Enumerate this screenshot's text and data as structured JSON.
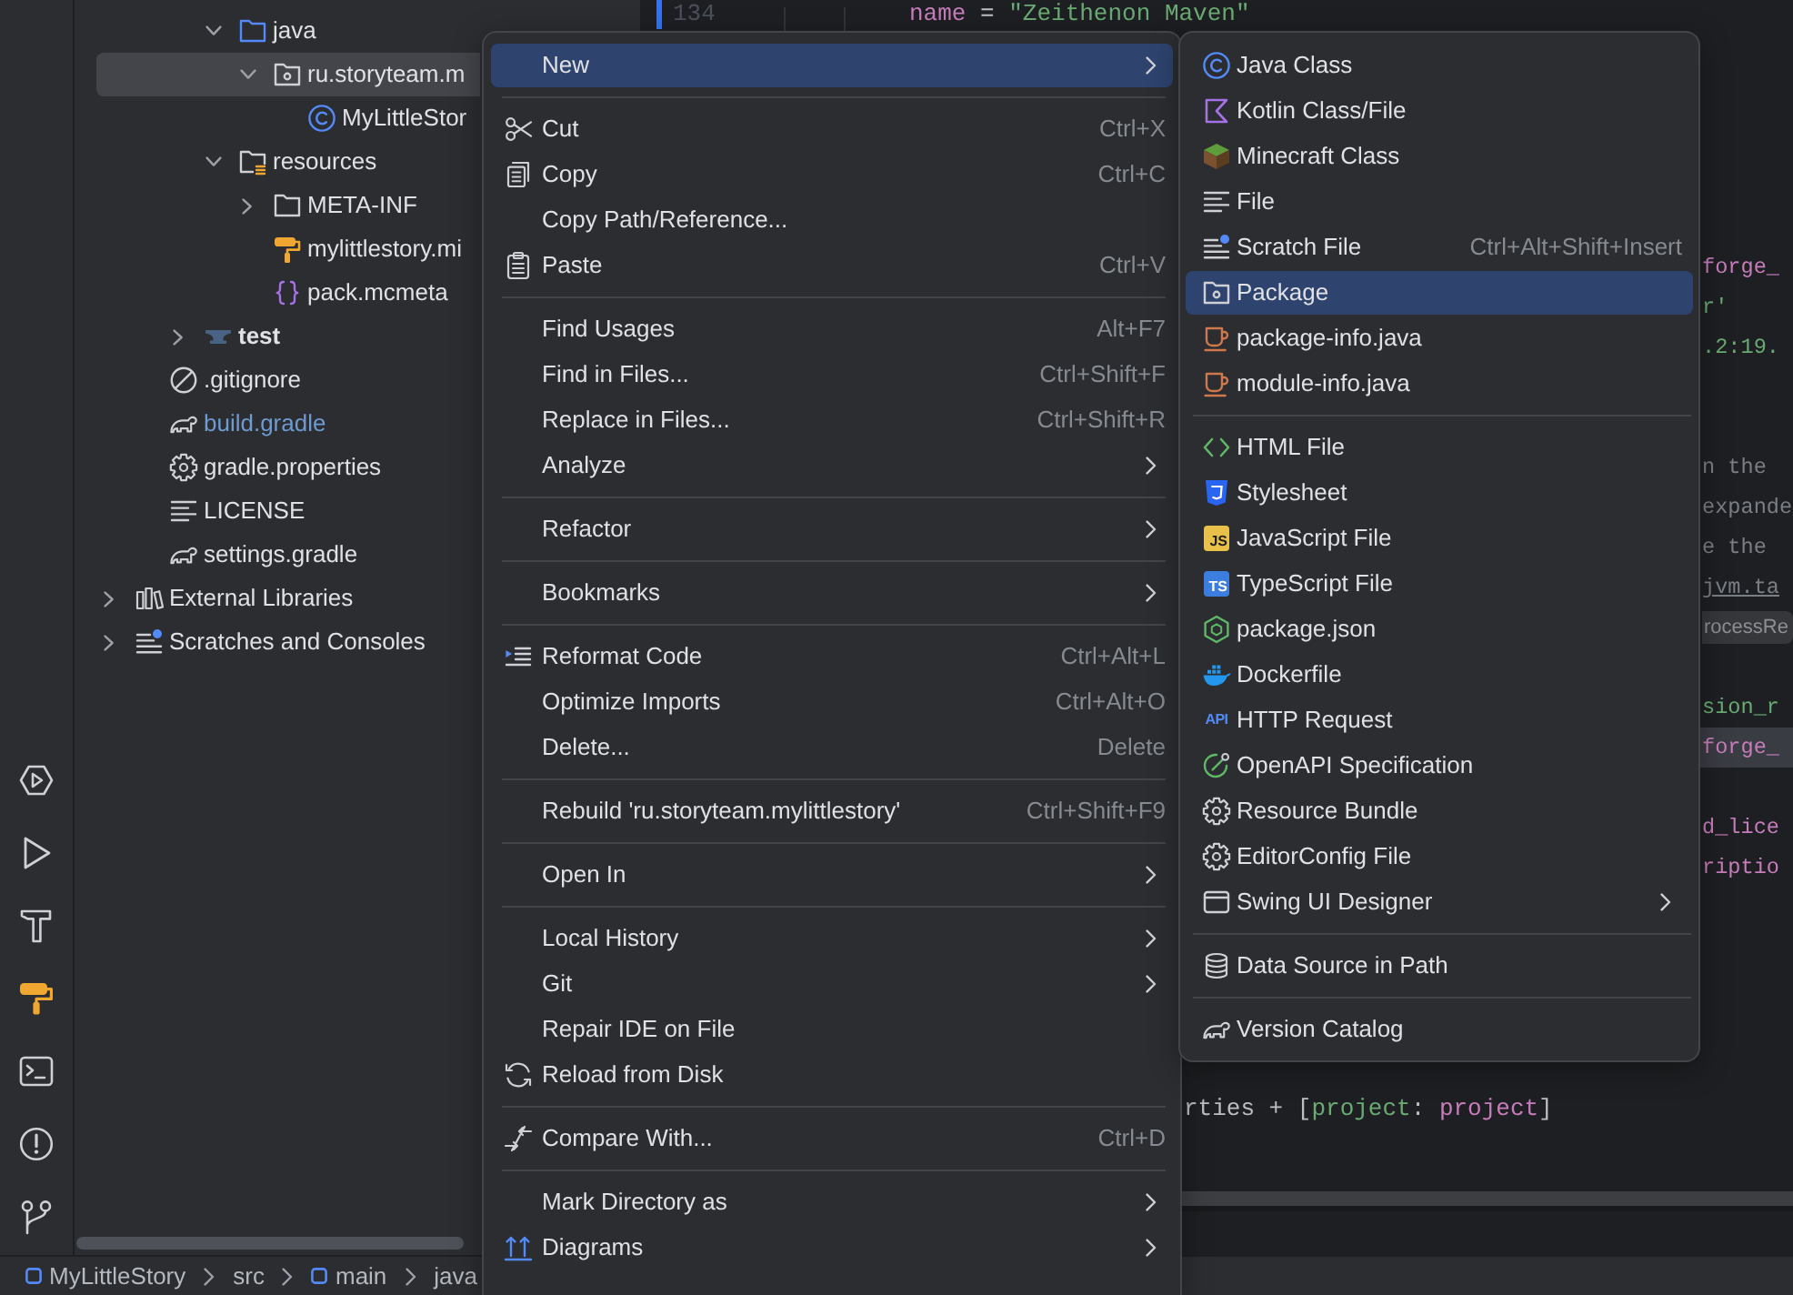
{
  "project_tree": [
    {
      "children": [
        {
          "children": [
            {
              "children": [
                {
                  "label": "java",
                  "kind": "source-folder",
                  "expanded": true,
                  "selected": false,
                  "modified": false,
                  "children": [
                    {
                      "label": "ru.storyteam.m",
                      "kind": "package",
                      "expanded": true,
                      "selected": true,
                      "modified": false,
                      "children": [
                        {
                          "label": "MyLittleStor",
                          "kind": "class",
                          "selected": false,
                          "modified": false
                        }
                      ]
                    }
                  ]
                },
                {
                  "label": "resources",
                  "kind": "resources-folder",
                  "expanded": true,
                  "selected": false,
                  "modified": false,
                  "children": [
                    {
                      "label": "META-INF",
                      "kind": "folder",
                      "expanded": false,
                      "selected": false,
                      "modified": false
                    },
                    {
                      "label": "mylittlestory.mi",
                      "kind": "mixin-config",
                      "selected": false,
                      "modified": false
                    },
                    {
                      "label": "pack.mcmeta",
                      "kind": "json",
                      "selected": false,
                      "modified": false
                    }
                  ]
                }
              ]
            },
            {
              "label": "test",
              "kind": "test-folder",
              "expanded": false,
              "selected": false,
              "modified": false
            }
          ]
        },
        {
          "label": ".gitignore",
          "kind": "ignore-file",
          "selected": false,
          "modified": false
        },
        {
          "label": "build.gradle",
          "kind": "gradle",
          "selected": false,
          "modified": true
        },
        {
          "label": "gradle.properties",
          "kind": "properties",
          "selected": false,
          "modified": false
        },
        {
          "label": "LICENSE",
          "kind": "text-file",
          "selected": false,
          "modified": false
        },
        {
          "label": "settings.gradle",
          "kind": "gradle",
          "selected": false,
          "modified": false
        }
      ]
    },
    {
      "label": "External Libraries",
      "kind": "libraries",
      "expanded": false,
      "selected": false,
      "modified": false
    },
    {
      "label": "Scratches and Consoles",
      "kind": "scratches",
      "expanded": false,
      "selected": false,
      "modified": false
    }
  ],
  "editor": {
    "gutter": {
      "line_number": "134",
      "changed": true
    },
    "lines": [
      {
        "highlighted": false,
        "tokens": [
          {
            "text": "name",
            "kind": "property"
          },
          {
            "text": " = ",
            "kind": "plain"
          },
          {
            "text": "\"Zeithenon Maven\"",
            "kind": "string"
          }
        ]
      },
      {
        "highlighted": false,
        "tokens": [
          {
            "text": "forge_",
            "kind": "property"
          }
        ]
      },
      {
        "highlighted": false,
        "tokens": [
          {
            "text": "r'",
            "kind": "string"
          }
        ]
      },
      {
        "highlighted": false,
        "tokens": [
          {
            "text": ".2:19.",
            "kind": "string"
          }
        ]
      },
      {
        "highlighted": false,
        "tokens": [
          {
            "text": "n the",
            "kind": "comment"
          }
        ]
      },
      {
        "highlighted": false,
        "tokens": [
          {
            "text": "expande",
            "kind": "comment"
          }
        ]
      },
      {
        "highlighted": false,
        "tokens": [
          {
            "text": "e the",
            "kind": "comment"
          }
        ]
      },
      {
        "highlighted": false,
        "tokens": [
          {
            "text": "jvm.ta",
            "kind": "link"
          }
        ]
      },
      {
        "highlighted": false,
        "tokens": [
          {
            "text": "rocessRe",
            "kind": "hint"
          }
        ]
      },
      {
        "highlighted": false,
        "tokens": [
          {
            "text": "sion_r",
            "kind": "string"
          }
        ]
      },
      {
        "highlighted": true,
        "tokens": [
          {
            "text": "forge_",
            "kind": "property"
          }
        ]
      },
      {
        "highlighted": false,
        "tokens": [
          {
            "text": "d_lice",
            "kind": "property"
          }
        ]
      },
      {
        "highlighted": false,
        "tokens": [
          {
            "text": "riptio",
            "kind": "property"
          }
        ]
      },
      {
        "highlighted": false,
        "tokens": [
          {
            "text": "rties + [",
            "kind": "plain"
          },
          {
            "text": "project",
            "kind": "argname"
          },
          {
            "text": ": ",
            "kind": "plain"
          },
          {
            "text": "project",
            "kind": "property"
          },
          {
            "text": "]",
            "kind": "plain"
          }
        ]
      }
    ]
  },
  "breadcrumbs": [
    {
      "label": "MyLittleStory",
      "kind": "module"
    },
    {
      "label": "src",
      "kind": "folder"
    },
    {
      "label": "main",
      "kind": "module"
    },
    {
      "label": "java",
      "kind": "folder"
    }
  ],
  "context_menu": {
    "items": [
      {
        "kind": "command",
        "label": "New",
        "has_submenu": true,
        "selected": true
      },
      {
        "kind": "separator"
      },
      {
        "kind": "cut",
        "label": "Cut",
        "shortcut": "Ctrl+X",
        "has_submenu": false,
        "selected": false
      },
      {
        "kind": "copy",
        "label": "Copy",
        "shortcut": "Ctrl+C",
        "has_submenu": false,
        "selected": false
      },
      {
        "kind": "command",
        "label": "Copy Path/Reference...",
        "has_submenu": false,
        "selected": false
      },
      {
        "kind": "paste",
        "label": "Paste",
        "shortcut": "Ctrl+V",
        "has_submenu": false,
        "selected": false
      },
      {
        "kind": "separator"
      },
      {
        "kind": "command",
        "label": "Find Usages",
        "shortcut": "Alt+F7",
        "has_submenu": false,
        "selected": false
      },
      {
        "kind": "command",
        "label": "Find in Files...",
        "shortcut": "Ctrl+Shift+F",
        "has_submenu": false,
        "selected": false
      },
      {
        "kind": "command",
        "label": "Replace in Files...",
        "shortcut": "Ctrl+Shift+R",
        "has_submenu": false,
        "selected": false
      },
      {
        "kind": "command",
        "label": "Analyze",
        "has_submenu": true,
        "selected": false
      },
      {
        "kind": "separator"
      },
      {
        "kind": "command",
        "label": "Refactor",
        "has_submenu": true,
        "selected": false
      },
      {
        "kind": "separator"
      },
      {
        "kind": "command",
        "label": "Bookmarks",
        "has_submenu": true,
        "selected": false
      },
      {
        "kind": "separator"
      },
      {
        "kind": "reformat",
        "label": "Reformat Code",
        "shortcut": "Ctrl+Alt+L",
        "has_submenu": false,
        "selected": false
      },
      {
        "kind": "command",
        "label": "Optimize Imports",
        "shortcut": "Ctrl+Alt+O",
        "has_submenu": false,
        "selected": false
      },
      {
        "kind": "command",
        "label": "Delete...",
        "shortcut": "Delete",
        "has_submenu": false,
        "selected": false
      },
      {
        "kind": "separator"
      },
      {
        "kind": "command",
        "label": "Rebuild 'ru.storyteam.mylittlestory'",
        "shortcut": "Ctrl+Shift+F9",
        "has_submenu": false,
        "selected": false
      },
      {
        "kind": "separator"
      },
      {
        "kind": "command",
        "label": "Open In",
        "has_submenu": true,
        "selected": false
      },
      {
        "kind": "separator"
      },
      {
        "kind": "command",
        "label": "Local History",
        "has_submenu": true,
        "selected": false
      },
      {
        "kind": "command",
        "label": "Git",
        "has_submenu": true,
        "selected": false
      },
      {
        "kind": "command",
        "label": "Repair IDE on File",
        "has_submenu": false,
        "selected": false
      },
      {
        "kind": "reload",
        "label": "Reload from Disk",
        "has_submenu": false,
        "selected": false
      },
      {
        "kind": "separator"
      },
      {
        "kind": "compare",
        "label": "Compare With...",
        "shortcut": "Ctrl+D",
        "has_submenu": false,
        "selected": false
      },
      {
        "kind": "separator"
      },
      {
        "kind": "command",
        "label": "Mark Directory as",
        "has_submenu": true,
        "selected": false
      },
      {
        "kind": "diagrams",
        "label": "Diagrams",
        "has_submenu": true,
        "selected": false
      }
    ]
  },
  "new_submenu": {
    "items": [
      {
        "kind": "java-class",
        "label": "Java Class",
        "has_submenu": false,
        "selected": false
      },
      {
        "kind": "kotlin",
        "label": "Kotlin Class/File",
        "has_submenu": false,
        "selected": false
      },
      {
        "kind": "minecraft",
        "label": "Minecraft Class",
        "has_submenu": false,
        "selected": false
      },
      {
        "kind": "file",
        "label": "File",
        "has_submenu": false,
        "selected": false
      },
      {
        "kind": "scratch",
        "label": "Scratch File",
        "shortcut": "Ctrl+Alt+Shift+Insert",
        "has_submenu": false,
        "selected": false
      },
      {
        "kind": "package",
        "label": "Package",
        "has_submenu": false,
        "selected": true
      },
      {
        "kind": "java-info",
        "label": "package-info.java",
        "has_submenu": false,
        "selected": false
      },
      {
        "kind": "java-info",
        "label": "module-info.java",
        "has_submenu": false,
        "selected": false
      },
      {
        "kind": "separator"
      },
      {
        "kind": "html",
        "label": "HTML File",
        "has_submenu": false,
        "selected": false
      },
      {
        "kind": "css",
        "label": "Stylesheet",
        "has_submenu": false,
        "selected": false
      },
      {
        "kind": "javascript",
        "tag": "JS",
        "label": "JavaScript File",
        "has_submenu": false,
        "selected": false
      },
      {
        "kind": "typescript",
        "tag": "TS",
        "label": "TypeScript File",
        "has_submenu": false,
        "selected": false
      },
      {
        "kind": "npm",
        "label": "package.json",
        "has_submenu": false,
        "selected": false
      },
      {
        "kind": "docker",
        "label": "Dockerfile",
        "has_submenu": false,
        "selected": false
      },
      {
        "kind": "http",
        "tag": "API",
        "label": "HTTP Request",
        "has_submenu": false,
        "selected": false
      },
      {
        "kind": "openapi",
        "label": "OpenAPI Specification",
        "has_submenu": false,
        "selected": false
      },
      {
        "kind": "bundle",
        "label": "Resource Bundle",
        "has_submenu": false,
        "selected": false
      },
      {
        "kind": "editorconfig",
        "label": "EditorConfig File",
        "has_submenu": false,
        "selected": false
      },
      {
        "kind": "swing",
        "label": "Swing UI Designer",
        "has_submenu": true,
        "selected": false
      },
      {
        "kind": "separator"
      },
      {
        "kind": "datasource",
        "label": "Data Source in Path",
        "has_submenu": false,
        "selected": false
      },
      {
        "kind": "separator"
      },
      {
        "kind": "catalog",
        "label": "Version Catalog",
        "has_submenu": false,
        "selected": false
      }
    ]
  }
}
